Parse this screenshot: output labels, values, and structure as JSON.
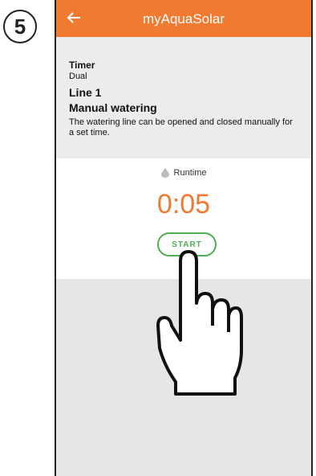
{
  "step": {
    "number": "5"
  },
  "appbar": {
    "title": "myAquaSolar",
    "back_icon": "arrow-left-icon"
  },
  "info": {
    "timer_label": "Timer",
    "timer_value": "Dual",
    "line_name": "Line 1",
    "mode_title": "Manual watering",
    "description": "The watering line can be opened and closed manually for a set time."
  },
  "runtime": {
    "label": "Runtime",
    "icon": "water-drop-icon",
    "value": "0:05",
    "start_label": "START"
  },
  "colors": {
    "accent": "#f07a30",
    "start_green": "#4cb050"
  }
}
